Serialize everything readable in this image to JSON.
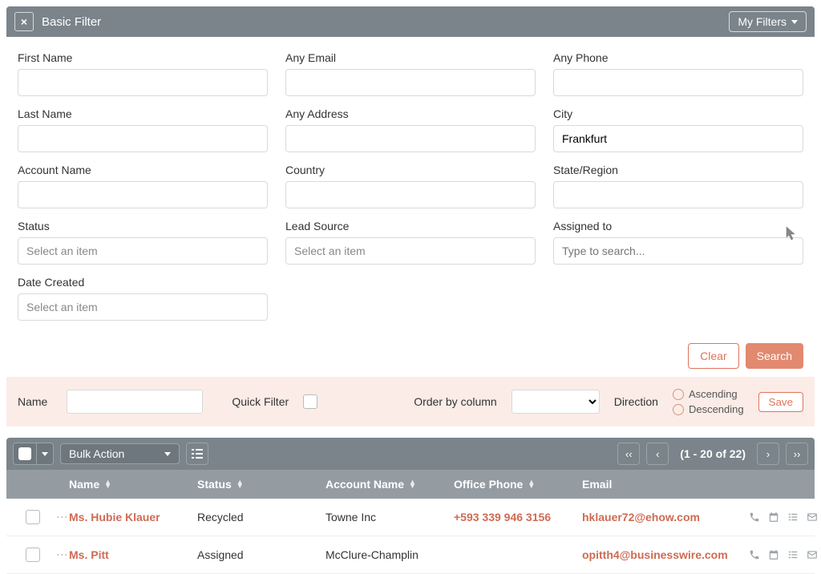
{
  "header": {
    "title": "Basic Filter",
    "myFilters": "My Filters"
  },
  "filters": {
    "firstName": {
      "label": "First Name",
      "value": ""
    },
    "anyEmail": {
      "label": "Any Email",
      "value": ""
    },
    "anyPhone": {
      "label": "Any Phone",
      "value": ""
    },
    "lastName": {
      "label": "Last Name",
      "value": ""
    },
    "anyAddress": {
      "label": "Any Address",
      "value": ""
    },
    "city": {
      "label": "City",
      "value": "Frankfurt"
    },
    "accountName": {
      "label": "Account Name",
      "value": ""
    },
    "country": {
      "label": "Country",
      "value": ""
    },
    "stateRegion": {
      "label": "State/Region",
      "value": ""
    },
    "status": {
      "label": "Status",
      "placeholder": "Select an item"
    },
    "leadSource": {
      "label": "Lead Source",
      "placeholder": "Select an item"
    },
    "assignedTo": {
      "label": "Assigned to",
      "placeholder": "Type to search..."
    },
    "dateCreated": {
      "label": "Date Created",
      "placeholder": "Select an item"
    }
  },
  "actions": {
    "clear": "Clear",
    "search": "Search"
  },
  "saveBar": {
    "nameLabel": "Name",
    "quickFilterLabel": "Quick Filter",
    "orderByLabel": "Order by column",
    "directionLabel": "Direction",
    "ascending": "Ascending",
    "descending": "Descending",
    "save": "Save"
  },
  "toolbar": {
    "bulkAction": "Bulk Action",
    "pageInfo": "(1 - 20 of 22)"
  },
  "columns": {
    "name": "Name",
    "status": "Status",
    "accountName": "Account Name",
    "officePhone": "Office Phone",
    "email": "Email"
  },
  "rows": [
    {
      "name": "Ms. Hubie Klauer",
      "status": "Recycled",
      "account": "Towne Inc",
      "phone": "+593 339 946 3156",
      "email": "hklauer72@ehow.com"
    },
    {
      "name": "Ms. Pitt",
      "status": "Assigned",
      "account": "McClure-Champlin",
      "phone": "",
      "email": "opitth4@businesswire.com"
    }
  ]
}
